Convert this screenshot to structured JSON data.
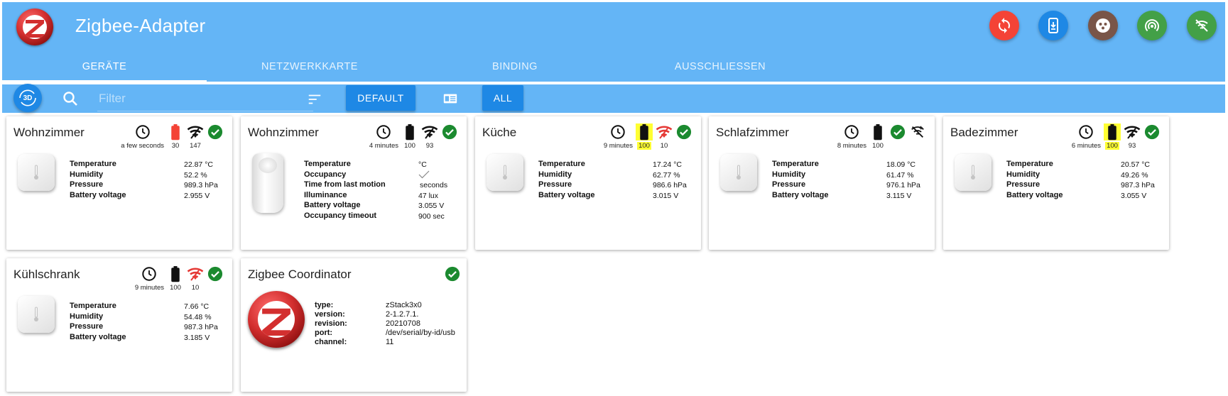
{
  "app": {
    "title": "Zigbee-Adapter"
  },
  "header_buttons": [
    {
      "name": "refresh-button",
      "icon": "refresh-icon",
      "color": "#f44336"
    },
    {
      "name": "firmware-update-button",
      "icon": "phone-download-icon",
      "color": "#1e88e5"
    },
    {
      "name": "groups-button",
      "icon": "group-dots-icon",
      "color": "#795548"
    },
    {
      "name": "pairing-button",
      "icon": "wifi-tethering-icon",
      "color": "#43a047"
    },
    {
      "name": "touchlink-button",
      "icon": "signal-off-icon",
      "color": "#43a047"
    }
  ],
  "tabs": [
    "GERÄTE",
    "NETZWERKKARTE",
    "BINDING",
    "AUSSCHLIESSEN"
  ],
  "toolbar": {
    "btn3d_label": "3D",
    "filter_placeholder": "Filter",
    "default_label": "DEFAULT",
    "all_label": "ALL"
  },
  "colors": {
    "header": "#64b5f6",
    "accent": "#1e88e5",
    "ok": "#1b8a2f",
    "warn": "#f44336",
    "highlight": "#ffff33"
  },
  "cards": [
    {
      "title": "Wohnzimmer",
      "time": "a few seconds",
      "battery": "30",
      "battery_low": true,
      "battery_highlight": false,
      "link": "147",
      "link_red": false,
      "labels": [
        "Temperature",
        "Humidity",
        "Pressure",
        "Battery voltage"
      ],
      "values": [
        "22.87 °C",
        "52.2 %",
        "989.3 hPa",
        "2.955 V"
      ]
    },
    {
      "title": "Wohnzimmer",
      "time": "4 minutes",
      "battery": "100",
      "battery_low": false,
      "battery_highlight": false,
      "link": "93",
      "link_red": false,
      "labels": [
        "Temperature",
        "Occupancy",
        "Time from last motion",
        "Illuminance",
        "Battery voltage",
        "Occupancy timeout"
      ],
      "values": [
        "°C",
        "",
        "seconds",
        "47 lux",
        "3.055 V",
        "900 sec"
      ]
    },
    {
      "title": "Küche",
      "time": "9 minutes",
      "battery": "100",
      "battery_low": false,
      "battery_highlight": true,
      "link": "10",
      "link_red": true,
      "labels": [
        "Temperature",
        "Humidity",
        "Pressure",
        "Battery voltage"
      ],
      "values": [
        "17.24 °C",
        "62.77 %",
        "986.6 hPa",
        "3.015 V"
      ]
    },
    {
      "title": "Schlafzimmer",
      "time": "8 minutes",
      "battery": "100",
      "battery_low": false,
      "battery_highlight": false,
      "link": "",
      "link_red": false,
      "no_link": true,
      "labels": [
        "Temperature",
        "Humidity",
        "Pressure",
        "Battery voltage"
      ],
      "values": [
        "18.09 °C",
        "61.47 %",
        "976.1 hPa",
        "3.115 V"
      ]
    },
    {
      "title": "Badezimmer",
      "time": "6 minutes",
      "battery": "100",
      "battery_low": false,
      "battery_highlight": true,
      "link": "93",
      "link_red": false,
      "labels": [
        "Temperature",
        "Humidity",
        "Pressure",
        "Battery voltage"
      ],
      "values": [
        "20.57 °C",
        "49.26 %",
        "987.3 hPa",
        "3.055 V"
      ]
    },
    {
      "title": "Kühlschrank",
      "time": "9 minutes",
      "battery": "100",
      "battery_low": false,
      "battery_highlight": false,
      "link": "10",
      "link_red": true,
      "labels": [
        "Temperature",
        "Humidity",
        "Pressure",
        "Battery voltage"
      ],
      "values": [
        "7.66 °C",
        "54.48 %",
        "987.3 hPa",
        "3.185 V"
      ]
    }
  ],
  "coordinator": {
    "title": "Zigbee Coordinator",
    "labels": [
      "type:",
      "version:",
      "revision:",
      "port:",
      "channel:"
    ],
    "values": [
      "zStack3x0",
      "2-1.2.7.1.",
      "20210708",
      "/dev/serial/by-id/usb",
      "11"
    ]
  }
}
